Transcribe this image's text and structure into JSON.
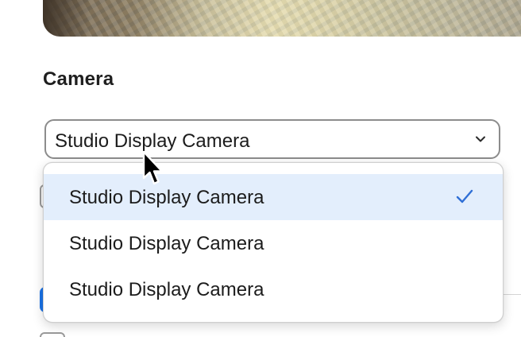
{
  "camera_section": {
    "title": "Camera",
    "selected_camera": "Studio Display Camera",
    "dropdown_open": true,
    "options": [
      {
        "label": "Studio Display Camera",
        "selected": true
      },
      {
        "label": "Studio Display Camera",
        "selected": false
      },
      {
        "label": "Studio Display Camera",
        "selected": false
      }
    ]
  },
  "icons": {
    "select_indicator": "chevron-down-icon",
    "selected_marker": "checkmark-icon",
    "pointer": "mouse-cursor-icon"
  },
  "colors": {
    "accent": "#1a73e8",
    "selected_row": "#e3eefc",
    "checkmark": "#2f6fd6"
  }
}
